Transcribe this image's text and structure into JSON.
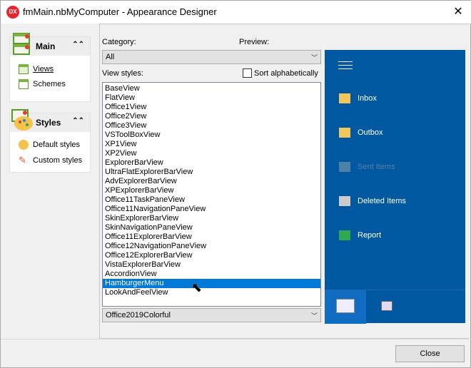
{
  "window": {
    "title": "fmMain.nbMyComputer  - Appearance Designer",
    "logo": "DX",
    "close_icon": "close-icon"
  },
  "sidebar": {
    "groups": [
      {
        "title": "Main",
        "items": [
          "Views",
          "Schemes"
        ]
      },
      {
        "title": "Styles",
        "items": [
          "Default styles",
          "Custom styles"
        ]
      }
    ]
  },
  "main": {
    "category_label": "Category:",
    "category_value": "All",
    "preview_label": "Preview:",
    "view_styles_label": "View styles:",
    "sort_label": "Sort alphabetically",
    "sort_checked": false,
    "view_styles": [
      "BaseView",
      "FlatView",
      "Office1View",
      "Office2View",
      "Office3View",
      "VSToolBoxView",
      "XP1View",
      "XP2View",
      "ExplorerBarView",
      "UltraFlatExplorerBarView",
      "AdvExplorerBarView",
      "XPExplorerBarView",
      "Office11TaskPaneView",
      "Office11NavigationPaneView",
      "SkinExplorerBarView",
      "SkinNavigationPaneView",
      "Office11ExplorerBarView",
      "Office12NavigationPaneView",
      "Office12ExplorerBarView",
      "VistaExplorerBarView",
      "AccordionView",
      "HamburgerMenu",
      "LookAndFeelView"
    ],
    "selected_style": "HamburgerMenu",
    "scheme_value": "Office2019Colorful"
  },
  "preview": {
    "bg": "#0059a0",
    "items": [
      {
        "label": "Inbox",
        "enabled": true
      },
      {
        "label": "Outbox",
        "enabled": true
      },
      {
        "label": "Sent Items",
        "enabled": false
      },
      {
        "label": "Deleted Items",
        "enabled": true
      },
      {
        "label": "Report",
        "enabled": true
      }
    ]
  },
  "footer": {
    "close_label": "Close"
  }
}
